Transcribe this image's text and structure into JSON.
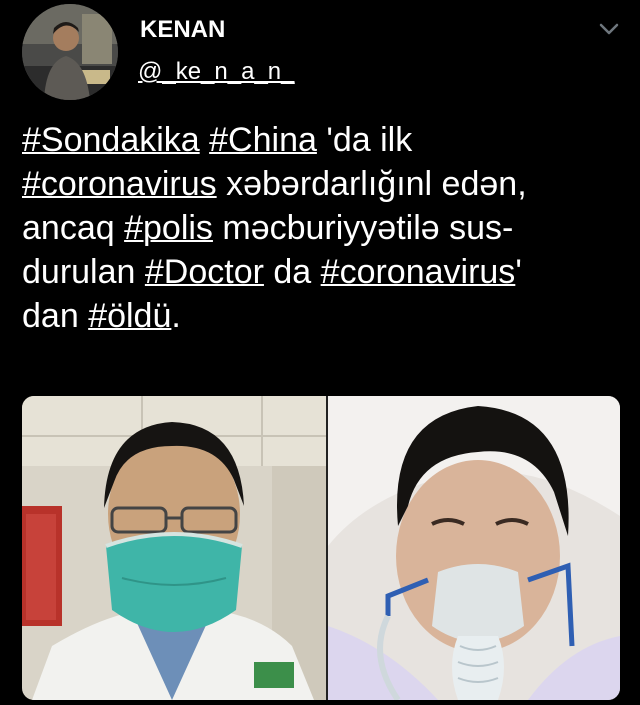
{
  "author": {
    "display_name": "KENAN",
    "handle": "@_ke_n_a_n_"
  },
  "icons": {
    "menu": "chevron-down-icon",
    "avatar": "avatar"
  },
  "tweet": {
    "lines": [
      [
        {
          "text": "#Sondakika",
          "hashtag": true
        },
        {
          "text": " ",
          "hashtag": false
        },
        {
          "text": "#China",
          "hashtag": true
        },
        {
          "text": " 'da ilk",
          "hashtag": false
        }
      ],
      [
        {
          "text": "#coronavirus",
          "hashtag": true
        },
        {
          "text": "   xəbərdarlığınl edən,",
          "hashtag": false
        }
      ],
      [
        {
          "text": "ancaq ",
          "hashtag": false
        },
        {
          "text": "#polis",
          "hashtag": true
        },
        {
          "text": " məcburiyyətilə sus-",
          "hashtag": false
        }
      ],
      [
        {
          "text": "durulan ",
          "hashtag": false
        },
        {
          "text": "#Doctor",
          "hashtag": true
        },
        {
          "text": " da ",
          "hashtag": false
        },
        {
          "text": "#coronavirus",
          "hashtag": true
        },
        {
          "text": "'",
          "hashtag": false
        }
      ],
      [
        {
          "text": "dan ",
          "hashtag": false
        },
        {
          "text": "#öldü",
          "hashtag": true
        },
        {
          "text": ".",
          "hashtag": false
        }
      ]
    ]
  },
  "colors": {
    "background": "#000000",
    "text": "#ffffff",
    "mask_green": "#3fb5a8",
    "oxygen_mask": "#dfe8ec",
    "strap_blue": "#2f5fb3"
  }
}
